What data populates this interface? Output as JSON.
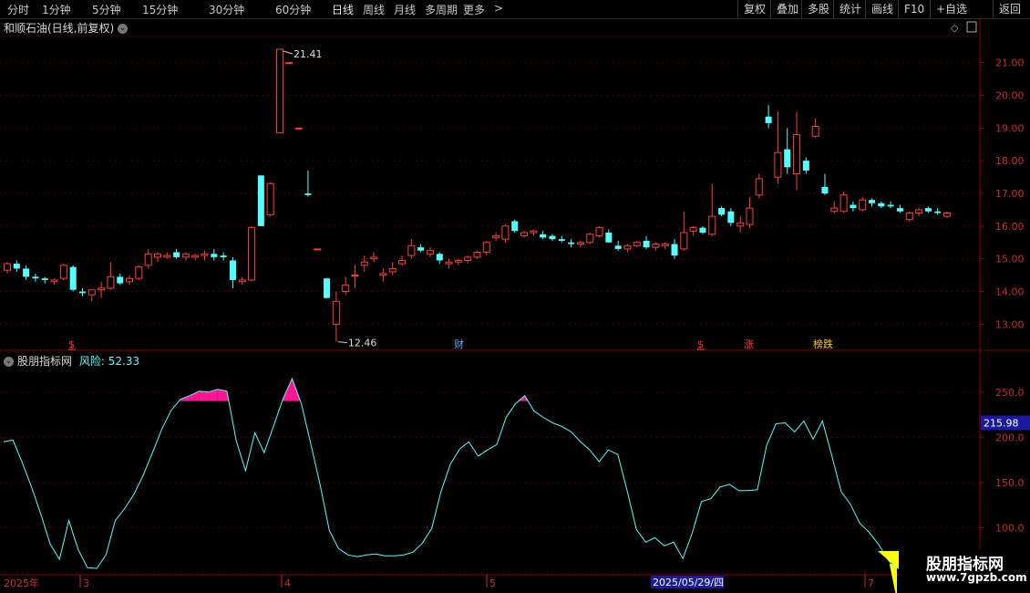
{
  "toolbar": {
    "periods": [
      "分时",
      "1分钟",
      "5分钟",
      "15分钟",
      "30分钟",
      "60分钟",
      "日线",
      "周线",
      "月线",
      "多周期",
      "更多"
    ],
    "active_period": "日线",
    "right_buttons": [
      "复权",
      "叠加",
      "多股",
      "统计",
      "画线",
      "F10",
      "+自选",
      "返回"
    ]
  },
  "stock": {
    "title": "和顺石油(日线,前复权)",
    "high_label": "21.41",
    "low_label": "12.46"
  },
  "event_markers": [
    {
      "label": "$",
      "color": "#ff3030"
    },
    {
      "label": "财",
      "color": "#60a8ff"
    },
    {
      "label": "$",
      "color": "#ff3030"
    },
    {
      "label": "涨",
      "color": "#ff4040"
    },
    {
      "label": "榜跌",
      "color": "#ffcc00"
    }
  ],
  "indicator": {
    "name": "股朋指标网",
    "value_name": "风险",
    "value": "52.33",
    "current_value_badge": "215.98"
  },
  "xaxis": {
    "labels": [
      "2025年",
      "3",
      "4",
      "5",
      "7"
    ],
    "cursor_date": "2025/05/29/四"
  },
  "watermark": {
    "title": "股朋指标网",
    "url": "www.7gpzb.com"
  },
  "colors": {
    "up": "#ff3c3c",
    "down": "#54ffff",
    "grid": "#8b0000",
    "line": "#54ffff",
    "fill_high": "#ff1493",
    "fill_low": "#ffff00"
  },
  "chart_data": [
    {
      "type": "candlestick",
      "title": "和顺石油(日线,前复权)",
      "ylim": [
        12.2,
        21.8
      ],
      "yticks": [
        13.0,
        14.0,
        15.0,
        16.0,
        17.0,
        18.0,
        19.0,
        20.0,
        21.0
      ],
      "series": [
        {
          "ohlc": [
            [
              14.65,
              14.9,
              14.55,
              14.85
            ],
            [
              14.85,
              14.95,
              14.6,
              14.7
            ],
            [
              14.7,
              14.8,
              14.35,
              14.45
            ],
            [
              14.45,
              14.55,
              14.3,
              14.4
            ],
            [
              14.4,
              14.45,
              14.25,
              14.35
            ],
            [
              14.3,
              14.4,
              14.2,
              14.35
            ],
            [
              14.4,
              14.85,
              14.35,
              14.8
            ],
            [
              14.75,
              14.8,
              14.0,
              14.05
            ],
            [
              14.0,
              14.1,
              13.85,
              13.95
            ],
            [
              13.9,
              14.0,
              13.7,
              14.05
            ],
            [
              14.05,
              14.3,
              13.8,
              14.1
            ],
            [
              14.1,
              14.9,
              14.05,
              14.45
            ],
            [
              14.45,
              14.55,
              14.2,
              14.25
            ],
            [
              14.3,
              14.5,
              14.2,
              14.4
            ],
            [
              14.4,
              14.8,
              14.35,
              14.75
            ],
            [
              14.8,
              15.3,
              14.7,
              15.15
            ],
            [
              15.05,
              15.2,
              14.9,
              15.15
            ],
            [
              15.05,
              15.2,
              15.0,
              15.1
            ],
            [
              15.2,
              15.3,
              15.0,
              15.05
            ],
            [
              15.05,
              15.2,
              14.95,
              15.15
            ],
            [
              15.05,
              15.15,
              14.95,
              15.1
            ],
            [
              15.1,
              15.25,
              14.95,
              15.15
            ],
            [
              15.15,
              15.3,
              14.95,
              15.05
            ],
            [
              15.1,
              15.2,
              14.95,
              15.05
            ],
            [
              14.95,
              15.05,
              14.1,
              14.35
            ],
            [
              14.3,
              14.45,
              14.2,
              14.35
            ],
            [
              14.35,
              16.0,
              14.3,
              15.95
            ],
            [
              17.55,
              17.55,
              16.0,
              16.0
            ],
            [
              16.35,
              17.35,
              16.3,
              17.3
            ],
            [
              18.85,
              21.41,
              18.85,
              21.41
            ],
            [
              21.0,
              21.0,
              21.0,
              21.0
            ],
            [
              19.0,
              19.0,
              19.0,
              19.0
            ],
            [
              17.0,
              17.7,
              16.9,
              16.95
            ],
            [
              15.3,
              15.3,
              15.3,
              15.3
            ],
            [
              14.4,
              14.4,
              13.8,
              13.8
            ],
            [
              13.0,
              14.0,
              12.46,
              13.7
            ],
            [
              14.0,
              14.45,
              13.9,
              14.2
            ],
            [
              14.5,
              14.8,
              14.1,
              14.5
            ],
            [
              14.8,
              15.1,
              14.6,
              14.9
            ],
            [
              15.0,
              15.2,
              14.9,
              15.05
            ],
            [
              14.5,
              14.7,
              14.3,
              14.55
            ],
            [
              14.6,
              14.9,
              14.5,
              14.7
            ],
            [
              14.85,
              15.1,
              14.8,
              14.95
            ],
            [
              15.1,
              15.6,
              15.0,
              15.4
            ],
            [
              15.35,
              15.45,
              15.2,
              15.25
            ],
            [
              15.15,
              15.35,
              15.05,
              15.25
            ],
            [
              15.15,
              15.2,
              14.85,
              14.95
            ],
            [
              14.85,
              15.0,
              14.7,
              14.9
            ],
            [
              14.9,
              15.0,
              14.8,
              14.95
            ],
            [
              14.95,
              15.1,
              14.85,
              15.05
            ],
            [
              15.05,
              15.25,
              15.0,
              15.2
            ],
            [
              15.2,
              15.55,
              15.1,
              15.5
            ],
            [
              15.65,
              15.8,
              15.55,
              15.7
            ],
            [
              15.6,
              16.05,
              15.5,
              16.0
            ],
            [
              16.15,
              16.2,
              15.8,
              15.85
            ],
            [
              15.7,
              15.85,
              15.65,
              15.8
            ],
            [
              15.8,
              15.9,
              15.7,
              15.85
            ],
            [
              15.75,
              15.85,
              15.6,
              15.65
            ],
            [
              15.7,
              15.75,
              15.55,
              15.6
            ],
            [
              15.6,
              15.7,
              15.5,
              15.55
            ],
            [
              15.5,
              15.6,
              15.35,
              15.45
            ],
            [
              15.45,
              15.55,
              15.35,
              15.5
            ],
            [
              15.5,
              15.8,
              15.45,
              15.75
            ],
            [
              15.7,
              16.0,
              15.65,
              15.95
            ],
            [
              15.8,
              15.9,
              15.5,
              15.5
            ],
            [
              15.4,
              15.55,
              15.25,
              15.3
            ],
            [
              15.3,
              15.45,
              15.2,
              15.4
            ],
            [
              15.4,
              15.55,
              15.35,
              15.5
            ],
            [
              15.55,
              15.7,
              15.3,
              15.35
            ],
            [
              15.35,
              15.5,
              15.25,
              15.45
            ],
            [
              15.4,
              15.5,
              15.3,
              15.45
            ],
            [
              15.45,
              15.6,
              15.0,
              15.1
            ],
            [
              15.3,
              16.45,
              15.25,
              15.8
            ],
            [
              15.85,
              16.0,
              15.7,
              15.95
            ],
            [
              15.95,
              16.0,
              15.75,
              15.8
            ],
            [
              15.75,
              17.3,
              15.7,
              16.3
            ],
            [
              16.55,
              16.6,
              16.3,
              16.35
            ],
            [
              16.45,
              16.55,
              16.0,
              16.1
            ],
            [
              16.0,
              16.3,
              15.8,
              16.1
            ],
            [
              16.05,
              16.9,
              15.95,
              16.55
            ],
            [
              16.95,
              17.6,
              16.85,
              17.45
            ],
            [
              19.35,
              19.7,
              19.0,
              19.15
            ],
            [
              17.5,
              19.5,
              17.3,
              18.25
            ],
            [
              18.35,
              19.0,
              17.6,
              17.8
            ],
            [
              17.6,
              19.5,
              17.1,
              18.8
            ],
            [
              18.0,
              18.1,
              17.6,
              17.7
            ],
            [
              18.75,
              19.3,
              18.7,
              19.05
            ],
            [
              17.2,
              17.6,
              16.95,
              17.0
            ],
            [
              16.45,
              16.75,
              16.4,
              16.55
            ],
            [
              16.45,
              17.05,
              16.4,
              16.95
            ],
            [
              16.65,
              16.75,
              16.45,
              16.55
            ],
            [
              16.5,
              16.9,
              16.45,
              16.8
            ],
            [
              16.8,
              16.85,
              16.6,
              16.7
            ],
            [
              16.7,
              16.75,
              16.55,
              16.6
            ],
            [
              16.65,
              16.75,
              16.55,
              16.6
            ],
            [
              16.55,
              16.65,
              16.4,
              16.45
            ],
            [
              16.2,
              16.45,
              16.15,
              16.4
            ],
            [
              16.4,
              16.55,
              16.3,
              16.5
            ],
            [
              16.55,
              16.6,
              16.4,
              16.45
            ],
            [
              16.45,
              16.55,
              16.35,
              16.4
            ],
            [
              16.3,
              16.45,
              16.25,
              16.4
            ]
          ]
        }
      ]
    },
    {
      "type": "line",
      "title": "股朋指标网",
      "ylim": [
        48,
        278
      ],
      "yticks": [
        50.0,
        100.0,
        150.0,
        200.0,
        250.0
      ],
      "threshold_high": 240,
      "threshold_low": 50,
      "series": [
        {
          "name": "风险",
          "values": [
            195,
            197,
            172,
            145,
            115,
            82,
            65,
            108,
            76,
            56,
            55,
            70,
            108,
            121,
            137,
            158,
            183,
            209,
            230,
            242,
            246,
            251,
            250,
            253,
            251,
            196,
            163,
            205,
            183,
            212,
            242,
            265,
            237,
            193,
            148,
            97,
            77,
            70,
            68,
            70,
            71,
            69,
            69,
            70,
            73,
            83,
            99,
            140,
            170,
            187,
            195,
            179,
            186,
            192,
            222,
            237,
            246,
            229,
            222,
            216,
            212,
            206,
            195,
            186,
            173,
            186,
            181,
            141,
            98,
            84,
            89,
            80,
            84,
            66,
            94,
            129,
            132,
            145,
            148,
            141,
            141,
            142,
            191,
            215,
            216,
            206,
            218,
            198,
            218,
            180,
            140,
            126,
            105,
            95,
            82,
            65,
            52
          ]
        }
      ]
    }
  ]
}
